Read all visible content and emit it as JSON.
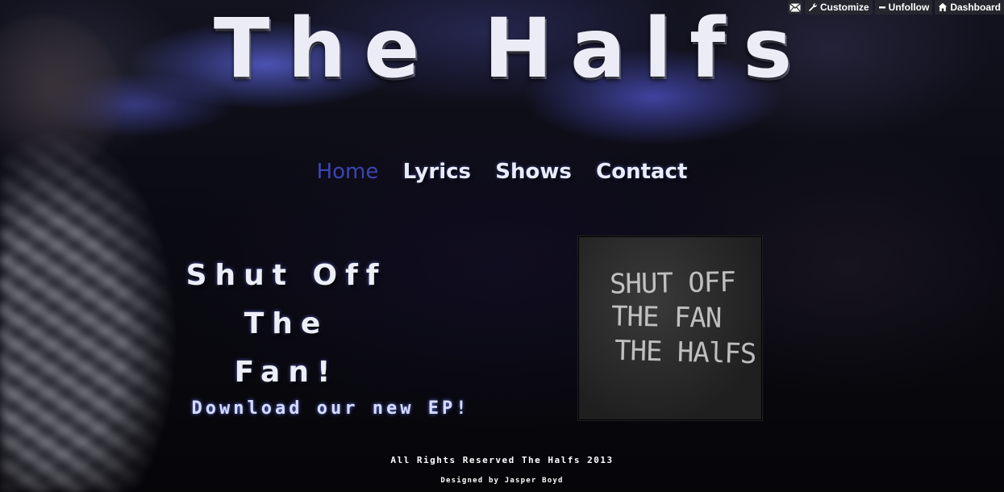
{
  "toolbar": {
    "mail_icon": "envelope-icon",
    "customize_label": "Customize",
    "unfollow_label": "Unfollow",
    "dashboard_label": "Dashboard"
  },
  "site": {
    "title": "The Halfs"
  },
  "nav": {
    "items": [
      {
        "label": "Home",
        "active": true
      },
      {
        "label": "Lyrics"
      },
      {
        "label": "Shows"
      },
      {
        "label": "Contact"
      }
    ]
  },
  "feature": {
    "title_line1": "Shut Off The",
    "title_line2": "Fan!",
    "download_link": "Download our new EP!",
    "cover_line1": "SHUT OFF",
    "cover_line2": "THE FAN",
    "cover_line3": "THE HAlFS"
  },
  "footer": {
    "rights": "All Rights Reserved The Halfs 2013",
    "credit": "Designed by Jasper Boyd"
  },
  "colors": {
    "nav_active": "#3c45b0",
    "nav_link": "#e9ecff",
    "title": "#ececf6"
  }
}
